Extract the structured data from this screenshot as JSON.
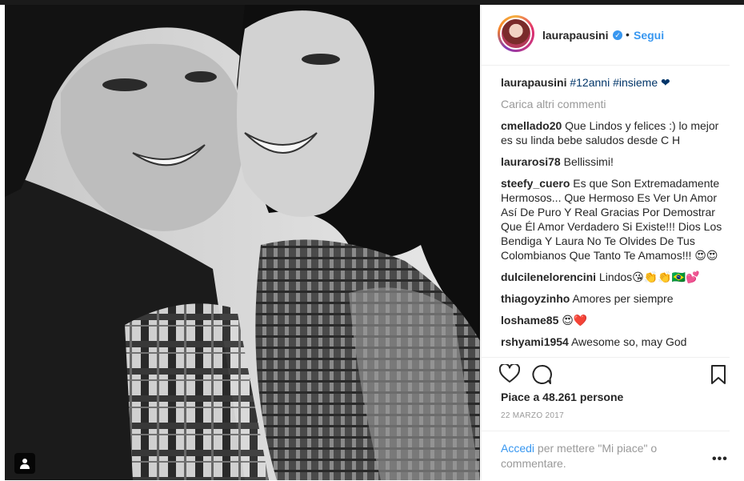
{
  "post": {
    "username": "laurapausini",
    "follow_label": "Segui",
    "separator": "•",
    "verified_icon": "verified-badge-icon",
    "caption": {
      "username": "laurapausini",
      "text": "#12anni #insieme ❤"
    },
    "load_more": "Carica altri commenti",
    "comments": [
      {
        "user": "cmellado20",
        "text": "Que Lindos y felices :) lo mejor es su linda bebe saludos desde C H"
      },
      {
        "user": "laurarosi78",
        "text": "Bellissimi!"
      },
      {
        "user": "steefy_cuero",
        "text": "Es que Son Extremadamente Hermosos... Que Hermoso Es Ver Un Amor Así De Puro Y Real Gracias Por Demostrar Que Él Amor Verdadero Si Existe!!! Dios Los Bendiga Y Laura No Te Olvides De Tus Colombianos Que Tanto Te Amamos!!! 😍😍"
      },
      {
        "user": "dulcilenelorencini",
        "text": "Lindos😘👏👏🇧🇷💕"
      },
      {
        "user": "thiagoyzinho",
        "text": "Amores per siempre"
      },
      {
        "user": "loshame85",
        "text": "😍❤️"
      },
      {
        "user": "rshyami1954",
        "text": "Awesome so, may God"
      }
    ],
    "likes": "Piace a 48.261 persone",
    "date": "22 MARZO 2017",
    "footer": {
      "login": "Accedi",
      "text": " per mettere \"Mi piace\" o commentare.",
      "more": "•••"
    }
  },
  "colors": {
    "link": "#3897f0",
    "hashtag": "#003569",
    "muted": "#999999",
    "text": "#262626"
  }
}
